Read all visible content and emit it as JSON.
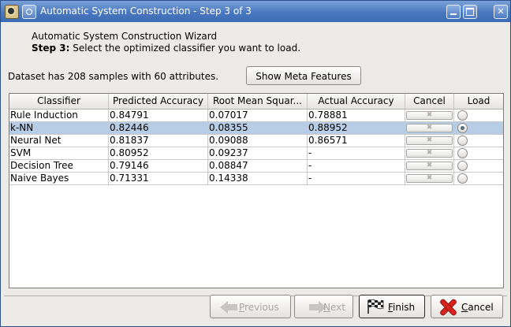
{
  "window": {
    "title": "Automatic System Construction - Step 3 of 3"
  },
  "wizard": {
    "heading": "Automatic System Construction Wizard",
    "step_label": "Step 3:",
    "step_text": " Select the optimized classifier you want to load."
  },
  "dataset": {
    "summary": "Dataset has 208 samples with 60 attributes.",
    "meta_button": "Show Meta Features"
  },
  "table": {
    "columns": [
      "Classifier",
      "Predicted Accuracy",
      "Root Mean Squar...",
      "Actual Accuracy",
      "Cancel",
      "Load"
    ],
    "rows": [
      {
        "classifier": "Rule Induction",
        "predicted": "0.84791",
        "rmse": "0.07017",
        "actual": "0.78881",
        "cancel": "✖",
        "selected": false
      },
      {
        "classifier": "k-NN",
        "predicted": "0.82446",
        "rmse": "0.08355",
        "actual": "0.88952",
        "cancel": "✖",
        "selected": true
      },
      {
        "classifier": "Neural Net",
        "predicted": "0.81837",
        "rmse": "0.09088",
        "actual": "0.86571",
        "cancel": "✖",
        "selected": false
      },
      {
        "classifier": "SVM",
        "predicted": "0.80952",
        "rmse": "0.09237",
        "actual": "-",
        "cancel": "✖",
        "selected": false
      },
      {
        "classifier": "Decision Tree",
        "predicted": "0.79146",
        "rmse": "0.08847",
        "actual": "-",
        "cancel": "✖",
        "selected": false
      },
      {
        "classifier": "Naive Bayes",
        "predicted": "0.71331",
        "rmse": "0.14338",
        "actual": "-",
        "cancel": "✖",
        "selected": false
      }
    ]
  },
  "footer": {
    "previous": {
      "first": "P",
      "rest": "revious"
    },
    "next": {
      "first": "N",
      "rest": "ext"
    },
    "finish": {
      "first": "F",
      "rest": "inish"
    },
    "cancel": {
      "first": "C",
      "rest": "ancel"
    }
  },
  "icons": {
    "app": "rapidminer-app-icon",
    "window_menu": "window-menu-icon",
    "previous": "arrow-left-icon",
    "next": "arrow-right-icon",
    "finish": "checkered-flag-icon",
    "cancel": "red-x-icon"
  },
  "colors": {
    "titlebar": "#4a78c0",
    "selection": "#b7cde6",
    "cancel_icon": "#d8241c"
  }
}
